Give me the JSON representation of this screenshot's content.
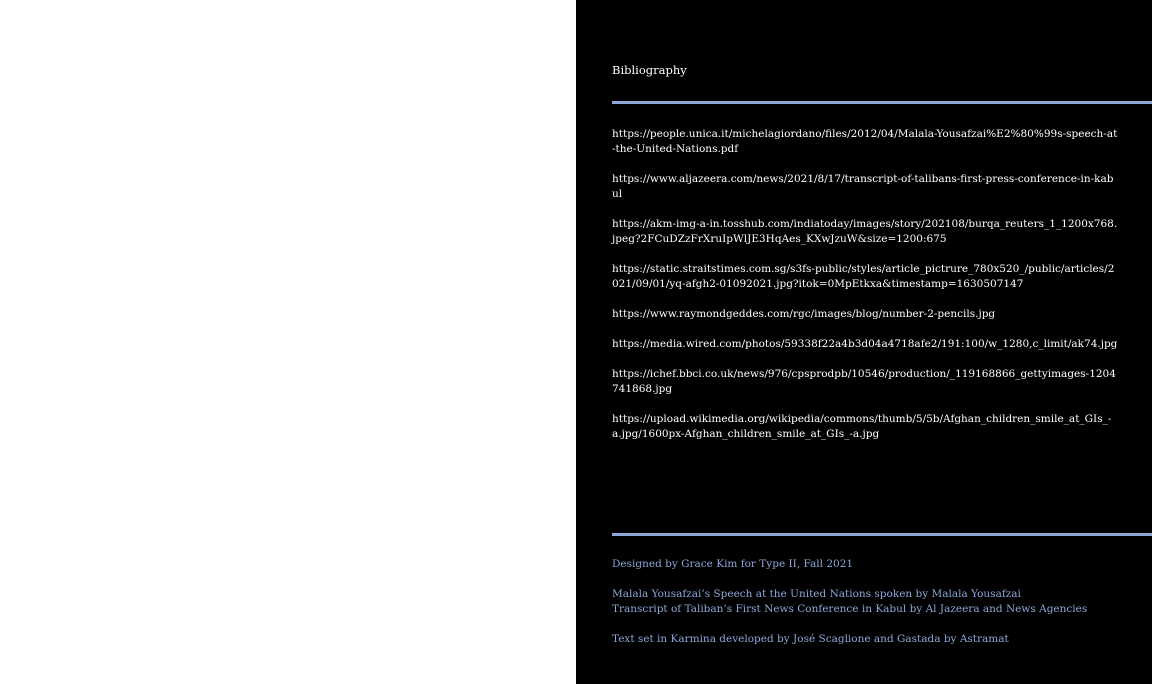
{
  "colors": {
    "page_background": "#000000",
    "accent": "#8ca7d8",
    "text": "#ffffff"
  },
  "bibliography": {
    "title": "Bibliography",
    "entries": [
      "https://people.unica.it/michelagiordano/files/2012/04/Malala-Yousafzai%E2%80%99s-speech-at-the-United-Nations.pdf",
      "https://www.aljazeera.com/news/2021/8/17/transcript-of-talibans-first-press-conference-in-kabul",
      "https://akm-img-a-in.tosshub.com/indiatoday/images/story/202108/burqa_reuters_1_1200x768.jpeg?2FCuDZzFrXruIpWlJE3HqAes_KXwJzuW&size=1200:675",
      "https://static.straitstimes.com.sg/s3fs-public/styles/article_pictrure_780x520_/public/articles/2021/09/01/yq-afgh2-01092021.jpg?itok=0MpEtkxa&timestamp=1630507147",
      "https://www.raymondgeddes.com/rgc/images/blog/number-2-pencils.jpg",
      "https://media.wired.com/photos/59338f22a4b3d04a4718afe2/191:100/w_1280,c_limit/ak74.jpg",
      "https://ichef.bbci.co.uk/news/976/cpsprodpb/10546/production/_119168866_gettyimages-1204741868.jpg",
      "https://upload.wikimedia.org/wikipedia/commons/thumb/5/5b/Afghan_children_smile_at_GIs_-a.jpg/1600px-Afghan_children_smile_at_GIs_-a.jpg"
    ]
  },
  "credits": {
    "designer": "Designed by Grace Kim for Type II, Fall 2021",
    "source_speech": "Malala Yousafzai’s Speech at the United Nations spoken by Malala Yousafzai",
    "source_transcript": "Transcript of Taliban’s First News Conference in Kabul by Al Jazeera and News Agencies",
    "typefaces": "Text set in Karmina developed by José Scaglione and Gastada by Astramat"
  }
}
